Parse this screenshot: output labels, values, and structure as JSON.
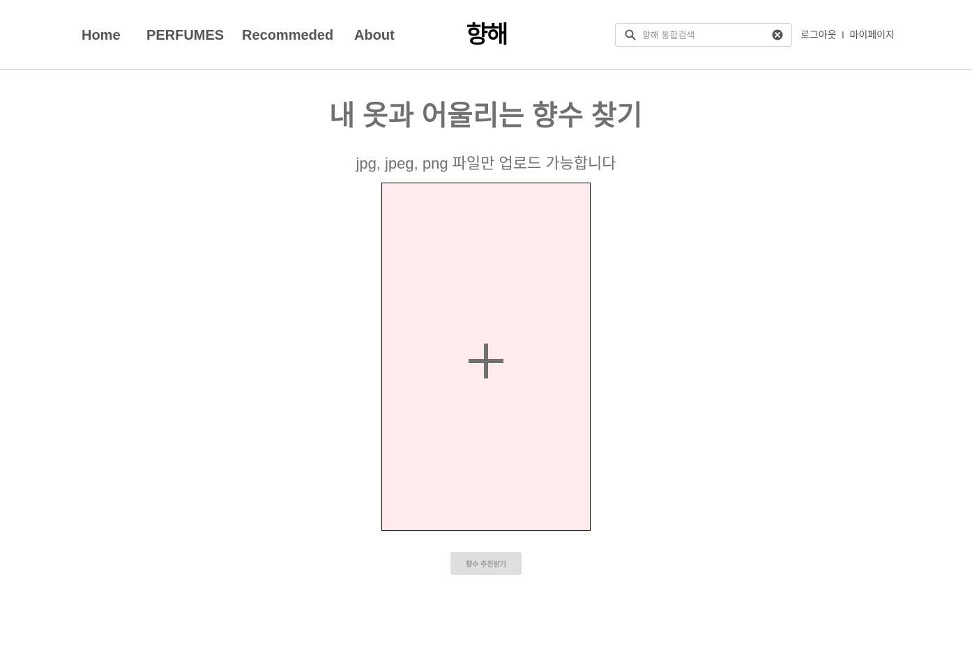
{
  "header": {
    "nav": [
      {
        "label": "Home"
      },
      {
        "label": "PERFUMES"
      },
      {
        "label": "Recommeded"
      },
      {
        "label": "About"
      }
    ],
    "logo_text": "향해",
    "search": {
      "placeholder": "향해 통합검색",
      "value": ""
    },
    "user_links": {
      "logout": "로그아웃",
      "divider": "l",
      "mypage": "마이페이지"
    }
  },
  "main": {
    "title": "내 옷과 어울리는 향수 찾기",
    "subtitle": "jpg, jpeg, png 파일만 업로드 가능합니다",
    "submit_label": "향수 추천받기"
  },
  "colors": {
    "upload_bg": "#ffebee",
    "text_gray": "#707070",
    "button_bg": "#dedede"
  }
}
